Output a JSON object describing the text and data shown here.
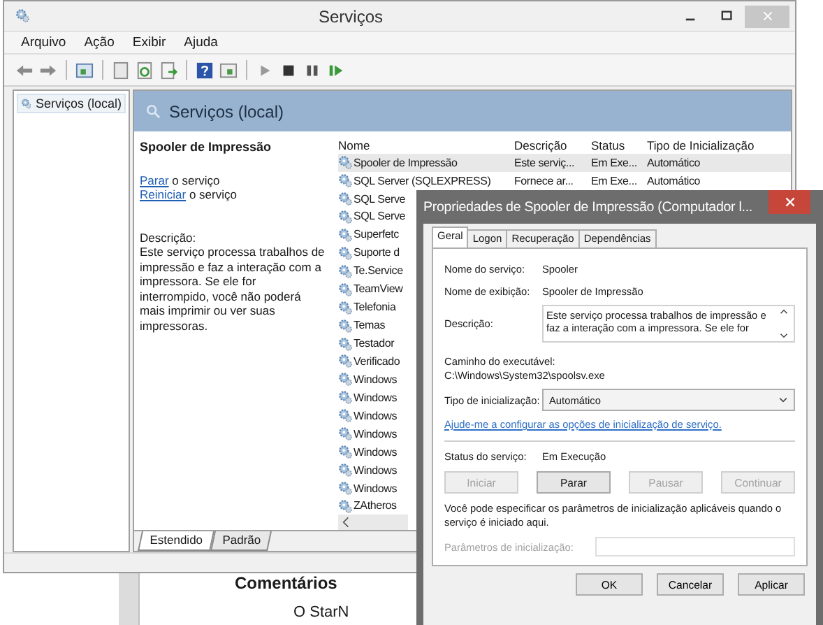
{
  "window": {
    "title": "Serviços"
  },
  "menu": [
    "Arquivo",
    "Ação",
    "Exibir",
    "Ajuda"
  ],
  "tree": {
    "items": [
      {
        "label": "Serviços (local)",
        "selected": true
      }
    ]
  },
  "pane": {
    "title": "Serviços (local)"
  },
  "details": {
    "service_name": "Spooler de Impressão",
    "actions": [
      {
        "link": "Parar",
        "text": "o serviço"
      },
      {
        "link": "Reiniciar",
        "text": "o serviço"
      }
    ],
    "description_label": "Descrição:",
    "description": "Este serviço processa trabalhos de impressão e faz a interação com a impressora. Se ele for interrompido, você não poderá mais imprimir ou ver suas impressoras."
  },
  "table": {
    "columns": [
      "Nome",
      "Descrição",
      "Status",
      "Tipo de Inicialização"
    ],
    "rows": [
      {
        "cells": [
          "Spooler de Impressão",
          "Este serviç...",
          "Em Exe...",
          "Automático"
        ],
        "selected": true
      },
      {
        "cells": [
          "SQL Server (SQLEXPRESS)",
          "Fornece ar...",
          "Em Exe...",
          "Automático"
        ],
        "selected": false
      },
      {
        "cells": [
          "SQL Serve"
        ],
        "selected": false
      },
      {
        "cells": [
          "SQL Serve"
        ],
        "selected": false
      },
      {
        "cells": [
          "Superfetc"
        ],
        "selected": false
      },
      {
        "cells": [
          "Suporte d"
        ],
        "selected": false
      },
      {
        "cells": [
          "Te.Service"
        ],
        "selected": false
      },
      {
        "cells": [
          "TeamView"
        ],
        "selected": false
      },
      {
        "cells": [
          "Telefonia"
        ],
        "selected": false
      },
      {
        "cells": [
          "Temas"
        ],
        "selected": false
      },
      {
        "cells": [
          "Testador"
        ],
        "selected": false
      },
      {
        "cells": [
          "Verificado"
        ],
        "selected": false
      },
      {
        "cells": [
          "Windows"
        ],
        "selected": false
      },
      {
        "cells": [
          "Windows"
        ],
        "selected": false
      },
      {
        "cells": [
          "Windows"
        ],
        "selected": false
      },
      {
        "cells": [
          "Windows"
        ],
        "selected": false
      },
      {
        "cells": [
          "Windows"
        ],
        "selected": false
      },
      {
        "cells": [
          "Windows"
        ],
        "selected": false
      },
      {
        "cells": [
          "Windows"
        ],
        "selected": false
      },
      {
        "cells": [
          "ZAtheros"
        ],
        "selected": false
      }
    ]
  },
  "view_tabs": [
    {
      "label": "Estendido",
      "selected": true
    },
    {
      "label": "Padrão",
      "selected": false
    }
  ],
  "background_document": {
    "heading": "Comentários",
    "item": "O StarN"
  },
  "dialog": {
    "title": "Propriedades de Spooler de Impressão (Computador l...",
    "tabs": [
      {
        "label": "Geral",
        "selected": true
      },
      {
        "label": "Logon",
        "selected": false
      },
      {
        "label": "Recuperação",
        "selected": false
      },
      {
        "label": "Dependências",
        "selected": false
      }
    ],
    "service_name": {
      "label": "Nome do serviço:",
      "value": "Spooler"
    },
    "display_name": {
      "label": "Nome de exibição:",
      "value": "Spooler de Impressão"
    },
    "description": {
      "label": "Descrição:",
      "value": "Este serviço processa trabalhos de impressão e faz a interação com a impressora. Se ele for"
    },
    "executable_path": {
      "label": "Caminho do executável:",
      "value": "C:\\Windows\\System32\\spoolsv.exe"
    },
    "startup_type": {
      "label": "Tipo de inicialização:",
      "value": "Automático"
    },
    "help_link": "Ajude-me a configurar as opções de inicialização de serviço.",
    "status": {
      "label": "Status do serviço:",
      "value": "Em Execução"
    },
    "control_buttons": [
      {
        "label": "Iniciar",
        "disabled": true
      },
      {
        "label": "Parar",
        "disabled": false
      },
      {
        "label": "Pausar",
        "disabled": true
      },
      {
        "label": "Continuar",
        "disabled": true
      }
    ],
    "note": "Você pode especificar os parâmetros de inicialização aplicáveis quando o serviço é iniciado aqui.",
    "start_parameters": {
      "label": "Parâmetros de inicialização:",
      "disabled": true
    },
    "buttons": [
      "OK",
      "Cancelar",
      "Aplicar"
    ]
  }
}
